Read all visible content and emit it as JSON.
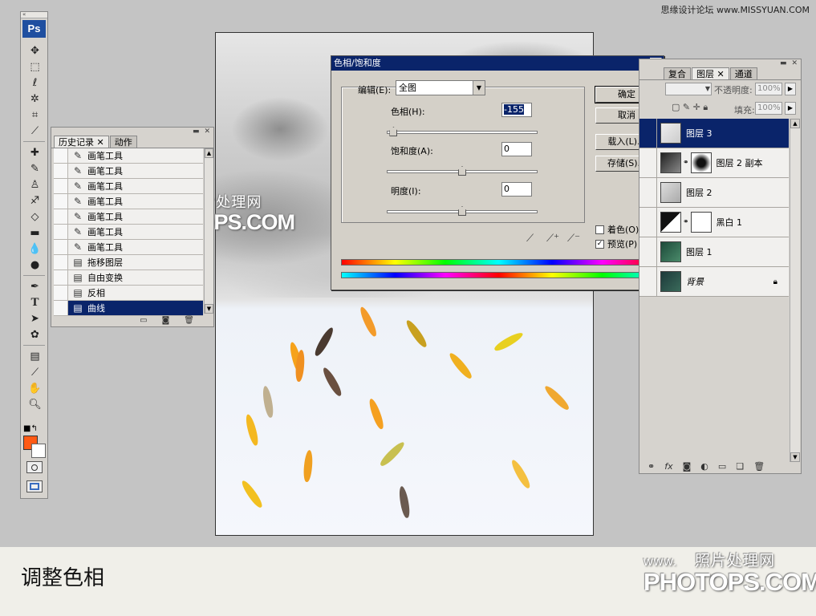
{
  "credit": "思缘设计论坛 www.MISSYUAN.COM",
  "toolbox": {
    "logo": "Ps",
    "tools": [
      "move-icon",
      "marquee-icon",
      "lasso-icon",
      "magic-wand-icon",
      "crop-icon",
      "slice-icon",
      "healing-brush-icon",
      "brush-icon",
      "clone-stamp-icon",
      "history-brush-icon",
      "eraser-icon",
      "gradient-icon",
      "blur-icon",
      "dodge-icon",
      "pen-icon",
      "type-icon",
      "path-selection-icon",
      "shape-icon",
      "notes-icon",
      "eyedropper-icon",
      "hand-icon",
      "zoom-icon"
    ],
    "foreground_color": "#ff5a14",
    "background_color": "#ffffff"
  },
  "history": {
    "tabs": [
      "历史记录",
      "动作"
    ],
    "items": [
      {
        "icon": "brush-icon",
        "label": "画笔工具"
      },
      {
        "icon": "brush-icon",
        "label": "画笔工具"
      },
      {
        "icon": "brush-icon",
        "label": "画笔工具"
      },
      {
        "icon": "brush-icon",
        "label": "画笔工具"
      },
      {
        "icon": "brush-icon",
        "label": "画笔工具"
      },
      {
        "icon": "brush-icon",
        "label": "画笔工具"
      },
      {
        "icon": "brush-icon",
        "label": "画笔工具"
      },
      {
        "icon": "document-icon",
        "label": "拖移图层"
      },
      {
        "icon": "document-icon",
        "label": "自由变换"
      },
      {
        "icon": "document-icon",
        "label": "反相"
      },
      {
        "icon": "document-icon",
        "label": "曲线"
      }
    ],
    "selected_index": 10
  },
  "dialog": {
    "title": "色相/饱和度",
    "close": "✕",
    "edit_label": "编辑(E):",
    "edit_value": "全图",
    "hue_label": "色相(H):",
    "hue_value": "-155",
    "hue_level": 0.04,
    "saturation_label": "饱和度(A):",
    "saturation_value": "0",
    "saturation_level": 0.5,
    "lightness_label": "明度(I):",
    "lightness_value": "0",
    "lightness_level": 0.5,
    "ok": "确定",
    "cancel": "取消",
    "load": "载入(L)...",
    "save": "存储(S)...",
    "colorize_label": "着色(O)",
    "colorize_checked": false,
    "preview_label": "预览(P)",
    "preview_checked": true,
    "preview_mark": "✓"
  },
  "layers": {
    "tabs": [
      "复合",
      "图层",
      "通道"
    ],
    "opacity_label": "不透明度:",
    "opacity_value": "100%",
    "fill_label": "填充:",
    "fill_value": "100%",
    "items": [
      {
        "name": "图层 3",
        "selected": true
      },
      {
        "name": "图层 2 副本",
        "selected": false
      },
      {
        "name": "图层 2",
        "selected": false
      },
      {
        "name": "黑白 1",
        "selected": false
      },
      {
        "name": "图层 1",
        "selected": false
      },
      {
        "name": "背景",
        "selected": false
      }
    ],
    "footer_icons": [
      "link-icon",
      "fx-icon",
      "mask-icon",
      "adjustment-icon",
      "group-icon",
      "new-layer-icon",
      "trash-icon"
    ]
  },
  "watermark": {
    "www": "www.",
    "cn": "照片处理网",
    "en": "PHOTOPS.COM"
  },
  "caption": "调整色相"
}
